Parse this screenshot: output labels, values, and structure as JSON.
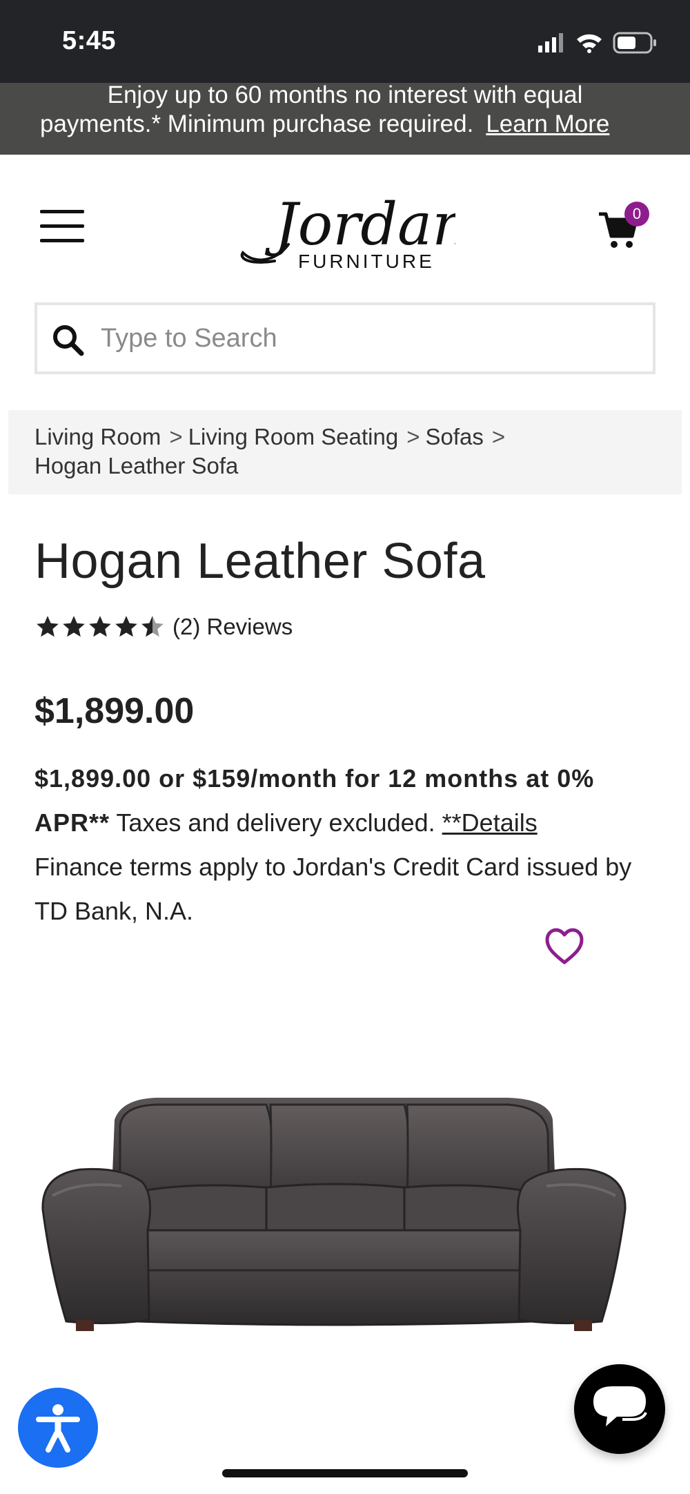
{
  "status_bar": {
    "time": "5:45"
  },
  "promo": {
    "line1": "Enjoy up to 60 months no interest with equal",
    "line2": "payments.* Minimum purchase required.",
    "link": "Learn More"
  },
  "header": {
    "logo_text": "Jordan's",
    "logo_subtext": "FURNITURE",
    "cart_count": "0"
  },
  "search": {
    "placeholder": "Type to Search"
  },
  "breadcrumb": {
    "items": [
      "Living Room",
      "Living Room Seating",
      "Sofas",
      "Hogan Leather Sofa"
    ],
    "separator": ">"
  },
  "product": {
    "title": "Hogan Leather Sofa",
    "rating": 4.5,
    "reviews": "(2) Reviews",
    "price": "$1,899.00",
    "finance_bold": "$1,899.00 or $159/month for 12 months at 0% APR**",
    "finance_text": " Taxes and delivery excluded. ",
    "finance_link": "**Details",
    "finance_note": "Finance terms apply to Jordan's Credit Card issued by TD Bank, N.A."
  },
  "colors": {
    "accent": "#8e1e8e",
    "status_bar_bg": "#232428",
    "promo_bg": "#4a4a48",
    "accessibility": "#1a6ff2"
  },
  "icons": {
    "menu": "hamburger-icon",
    "cart": "cart-icon",
    "search": "search-icon",
    "favorite": "heart-icon",
    "accessibility": "accessibility-icon",
    "chat": "chat-icon"
  }
}
